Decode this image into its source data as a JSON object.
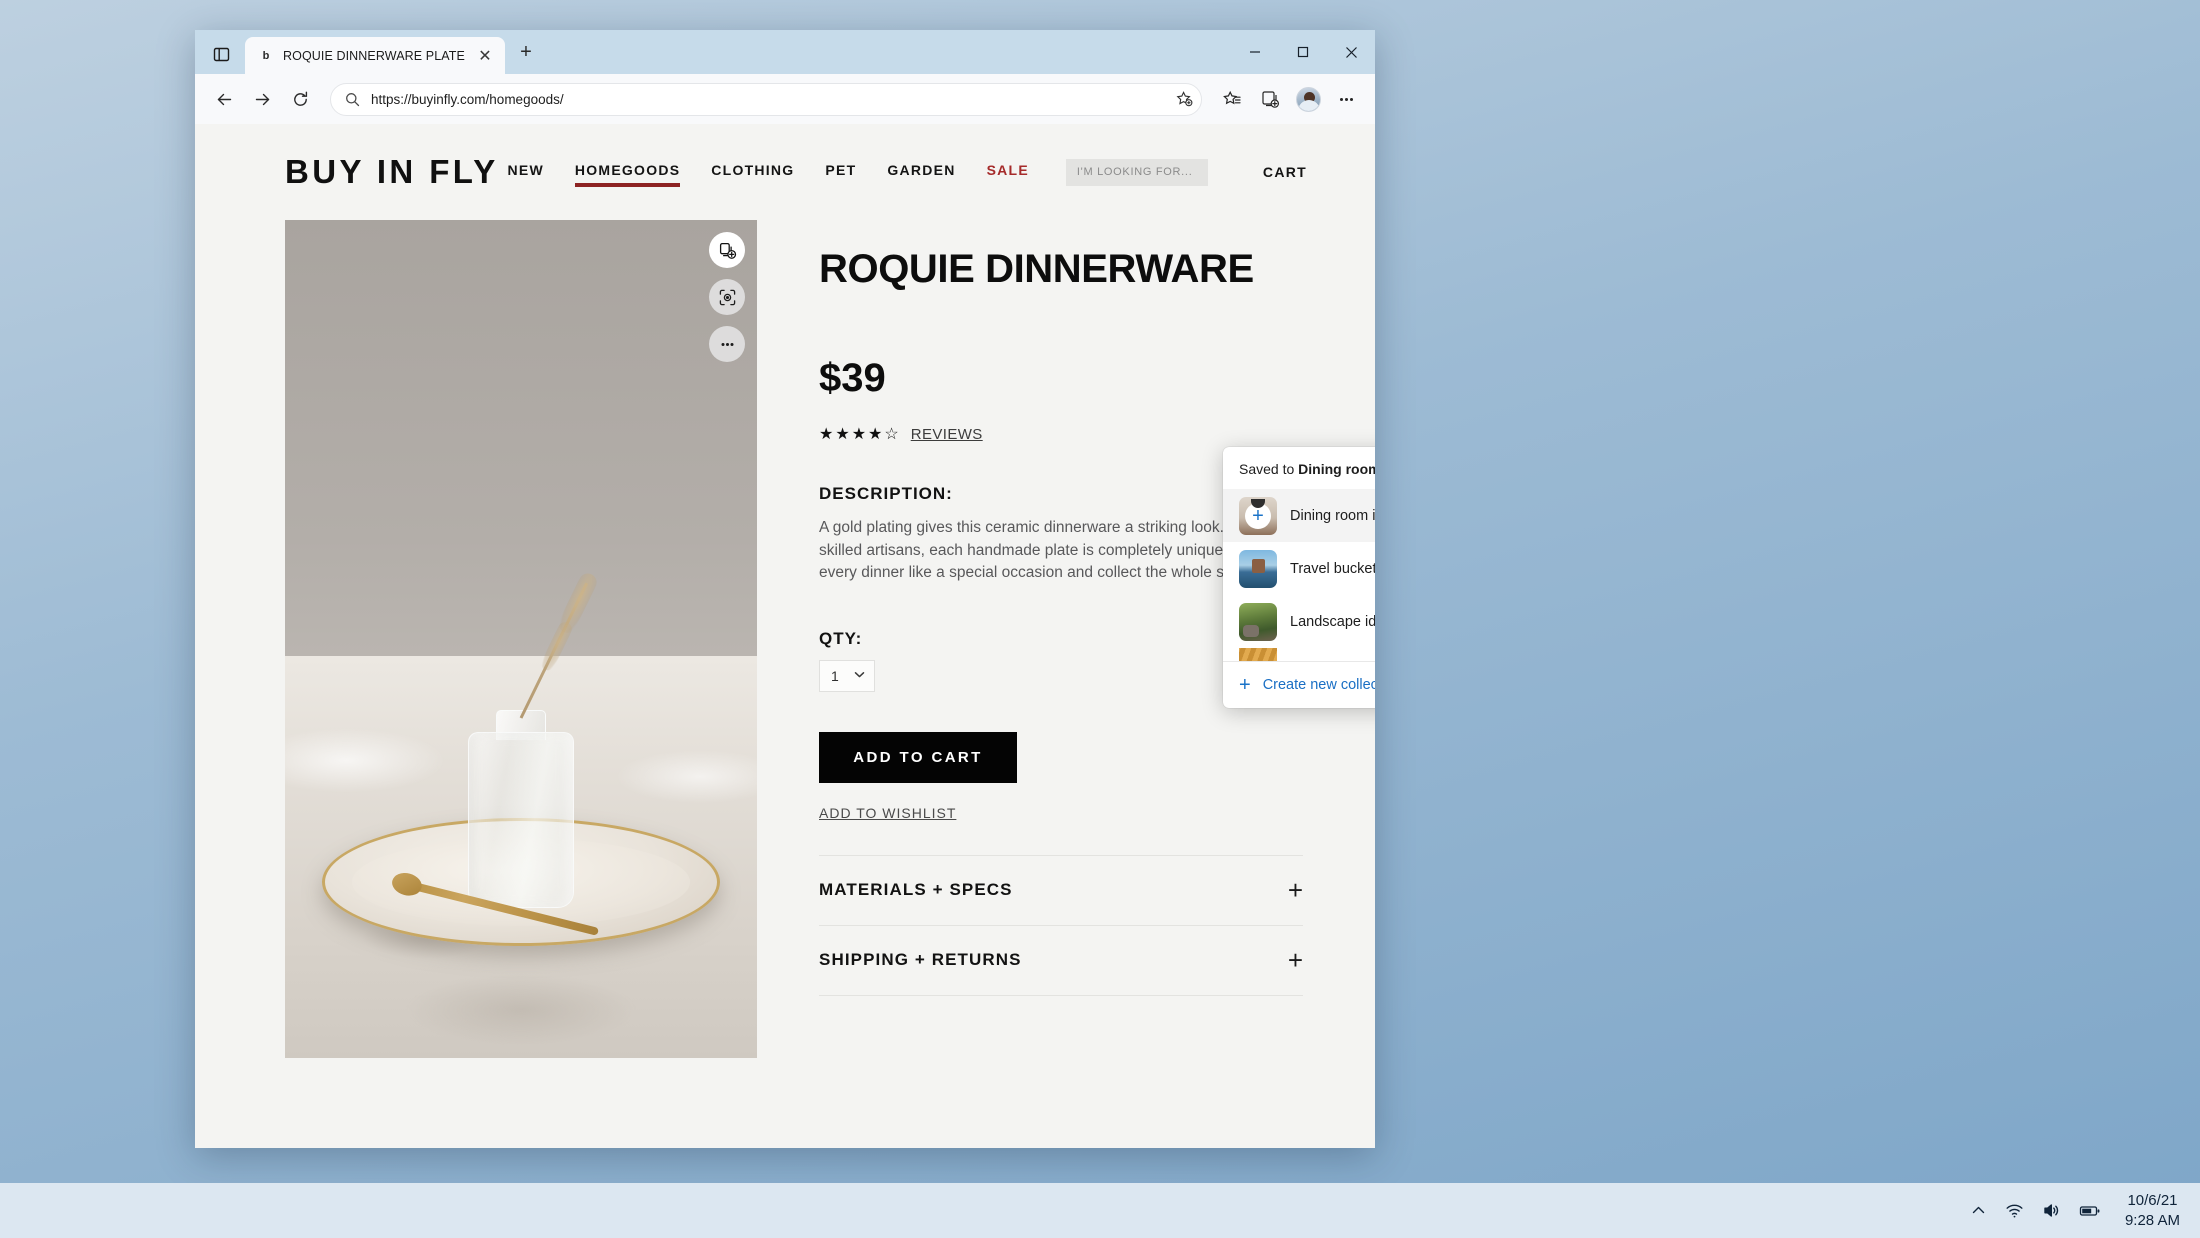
{
  "browser": {
    "tab": {
      "title": "ROQUIE DINNERWARE  PLATE",
      "favicon": "b",
      "close_label": "✕"
    },
    "new_tab_label": "+",
    "tab_search_icon": "tab-search-icon",
    "window_controls": {
      "minimize": "–",
      "maximize": "☐",
      "close": "✕"
    },
    "toolbar": {
      "back_icon": "back-arrow-icon",
      "forward_icon": "forward-arrow-icon",
      "refresh_icon": "refresh-icon",
      "search_icon": "search-icon",
      "url": "https://buyinfly.com/homegoods/",
      "add_favorite_icon": "add-favorite-star-icon",
      "favorites_icon": "favorites-list-icon",
      "collections_icon": "collections-add-icon",
      "profile_icon": "profile-avatar",
      "settings_icon": "more-ellipsis-icon"
    }
  },
  "site": {
    "brand": "BUY IN FLY",
    "nav": [
      {
        "label": "NEW",
        "active": false,
        "sale": false
      },
      {
        "label": "HOMEGOODS",
        "active": true,
        "sale": false
      },
      {
        "label": "CLOTHING",
        "active": false,
        "sale": false
      },
      {
        "label": "PET",
        "active": false,
        "sale": false
      },
      {
        "label": "GARDEN",
        "active": false,
        "sale": false
      },
      {
        "label": "SALE",
        "active": false,
        "sale": true
      }
    ],
    "search_placeholder": "I'M LOOKING FOR...",
    "cart_label": "CART"
  },
  "product": {
    "title": "ROQUIE DINNERWARE",
    "price": "$39",
    "stars": "★★★★☆",
    "reviews_link": "REVIEWS",
    "description_heading": "DESCRIPTION:",
    "description_body": "A gold plating gives this ceramic dinnerware a striking look. Made by skilled artisans, each handmade plate is completely unique. Treat every dinner like a special occasion and collect the whole set.",
    "qty_heading": "QTY:",
    "qty_value": "1",
    "add_to_cart_label": "ADD TO CART",
    "add_to_wishlist_label": "ADD TO WISHLIST",
    "accordions": [
      {
        "label": "MATERIALS + SPECS",
        "toggle": "+"
      },
      {
        "label": "SHIPPING + RETURNS",
        "toggle": "+"
      }
    ],
    "photo_actions": [
      {
        "name": "add-to-collections-icon",
        "active": true
      },
      {
        "name": "visual-search-icon",
        "active": false
      },
      {
        "name": "more-options-icon",
        "active": false
      }
    ]
  },
  "collections_popup": {
    "saved_prefix": "Saved to ",
    "saved_collection": "Dining room ideas",
    "items": [
      {
        "name": "Dining room ideas",
        "thumb": "th-dining",
        "selected": true,
        "badge": "+"
      },
      {
        "name": "Travel bucketlist",
        "thumb": "th-travel",
        "selected": false,
        "badge": ""
      },
      {
        "name": "Landscape ideas and in...",
        "thumb": "th-landscape",
        "selected": false,
        "badge": ""
      }
    ],
    "partial_item_thumb": "th-basket",
    "create_label": "Create new collection",
    "create_plus": "+",
    "accent_color": "#1a6fc4"
  },
  "taskbar": {
    "show_hidden_icon": "chevron-up-icon",
    "wifi_icon": "wifi-icon",
    "volume_icon": "speaker-icon",
    "battery_icon": "battery-icon",
    "date": "10/6/21",
    "time": "9:28 AM"
  }
}
